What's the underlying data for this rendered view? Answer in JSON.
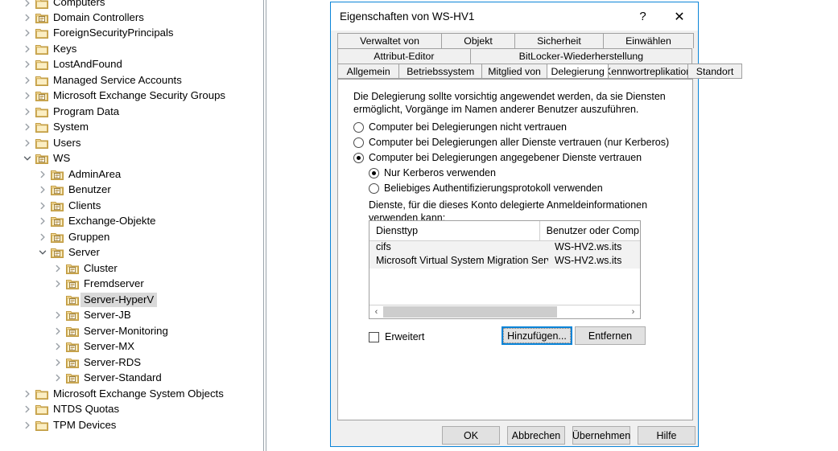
{
  "tree": {
    "items": [
      {
        "label": "Computers",
        "depth": 1,
        "twisty": "collapsed",
        "icon": "folder-plain-icon",
        "selected": false,
        "clipped_top": true
      },
      {
        "label": "Domain Controllers",
        "depth": 1,
        "twisty": "collapsed",
        "icon": "folder-ou-icon",
        "selected": false
      },
      {
        "label": "ForeignSecurityPrincipals",
        "depth": 1,
        "twisty": "collapsed",
        "icon": "folder-plain-icon",
        "selected": false
      },
      {
        "label": "Keys",
        "depth": 1,
        "twisty": "collapsed",
        "icon": "folder-plain-icon",
        "selected": false
      },
      {
        "label": "LostAndFound",
        "depth": 1,
        "twisty": "collapsed",
        "icon": "folder-plain-icon",
        "selected": false
      },
      {
        "label": "Managed Service Accounts",
        "depth": 1,
        "twisty": "collapsed",
        "icon": "folder-plain-icon",
        "selected": false
      },
      {
        "label": "Microsoft Exchange Security Groups",
        "depth": 1,
        "twisty": "collapsed",
        "icon": "folder-ou-icon",
        "selected": false
      },
      {
        "label": "Program Data",
        "depth": 1,
        "twisty": "collapsed",
        "icon": "folder-plain-icon",
        "selected": false
      },
      {
        "label": "System",
        "depth": 1,
        "twisty": "collapsed",
        "icon": "folder-plain-icon",
        "selected": false
      },
      {
        "label": "Users",
        "depth": 1,
        "twisty": "collapsed",
        "icon": "folder-plain-icon",
        "selected": false
      },
      {
        "label": "WS",
        "depth": 1,
        "twisty": "expanded",
        "icon": "folder-ou-icon",
        "selected": false
      },
      {
        "label": "AdminArea",
        "depth": 2,
        "twisty": "collapsed",
        "icon": "folder-ou-icon",
        "selected": false
      },
      {
        "label": "Benutzer",
        "depth": 2,
        "twisty": "collapsed",
        "icon": "folder-ou-icon",
        "selected": false
      },
      {
        "label": "Clients",
        "depth": 2,
        "twisty": "collapsed",
        "icon": "folder-ou-icon",
        "selected": false
      },
      {
        "label": "Exchange-Objekte",
        "depth": 2,
        "twisty": "collapsed",
        "icon": "folder-ou-icon",
        "selected": false
      },
      {
        "label": "Gruppen",
        "depth": 2,
        "twisty": "collapsed",
        "icon": "folder-ou-icon",
        "selected": false
      },
      {
        "label": "Server",
        "depth": 2,
        "twisty": "expanded",
        "icon": "folder-ou-icon",
        "selected": false
      },
      {
        "label": "Cluster",
        "depth": 3,
        "twisty": "collapsed",
        "icon": "folder-ou-icon",
        "selected": false
      },
      {
        "label": "Fremdserver",
        "depth": 3,
        "twisty": "collapsed",
        "icon": "folder-ou-icon",
        "selected": false
      },
      {
        "label": "Server-HyperV",
        "depth": 3,
        "twisty": "none",
        "icon": "folder-ou-icon",
        "selected": true
      },
      {
        "label": "Server-JB",
        "depth": 3,
        "twisty": "collapsed",
        "icon": "folder-ou-icon",
        "selected": false
      },
      {
        "label": "Server-Monitoring",
        "depth": 3,
        "twisty": "collapsed",
        "icon": "folder-ou-icon",
        "selected": false
      },
      {
        "label": "Server-MX",
        "depth": 3,
        "twisty": "collapsed",
        "icon": "folder-ou-icon",
        "selected": false
      },
      {
        "label": "Server-RDS",
        "depth": 3,
        "twisty": "collapsed",
        "icon": "folder-ou-icon",
        "selected": false
      },
      {
        "label": "Server-Standard",
        "depth": 3,
        "twisty": "collapsed",
        "icon": "folder-ou-icon",
        "selected": false
      },
      {
        "label": "Microsoft Exchange System Objects",
        "depth": 1,
        "twisty": "collapsed",
        "icon": "folder-plain-icon",
        "selected": false
      },
      {
        "label": "NTDS Quotas",
        "depth": 1,
        "twisty": "collapsed",
        "icon": "folder-plain-icon",
        "selected": false
      },
      {
        "label": "TPM Devices",
        "depth": 1,
        "twisty": "collapsed",
        "icon": "folder-plain-icon",
        "selected": false
      }
    ]
  },
  "dialog": {
    "title": "Eigenschaften von WS-HV1",
    "help_label": "?",
    "close_label": "✕",
    "accent_color": "#0a84d8",
    "tab_rows": [
      [
        {
          "label": "Verwaltet von",
          "active": false
        },
        {
          "label": "Objekt",
          "active": false
        },
        {
          "label": "Sicherheit",
          "active": false
        },
        {
          "label": "Einwählen",
          "active": false
        }
      ],
      [
        {
          "label": "Attribut-Editor",
          "active": false
        },
        {
          "label": "BitLocker-Wiederherstellung",
          "active": false
        }
      ],
      [
        {
          "label": "Allgemein",
          "active": false
        },
        {
          "label": "Betriebssystem",
          "active": false
        },
        {
          "label": "Mitglied von",
          "active": false
        },
        {
          "label": "Delegierung",
          "active": true
        },
        {
          "label": "Kennwortreplikation",
          "active": false
        },
        {
          "label": "Standort",
          "active": false
        }
      ]
    ],
    "page": {
      "description_line1": "Die Delegierung sollte vorsichtig angewendet werden, da sie Diensten",
      "description_line2": "ermöglicht, Vorgänge im Namen anderer Benutzer auszuführen.",
      "options": [
        {
          "label": "Computer bei Delegierungen nicht vertrauen",
          "selected": false
        },
        {
          "label": "Computer bei Delegierungen aller Dienste vertrauen (nur Kerberos)",
          "selected": false
        },
        {
          "label": "Computer bei Delegierungen angegebener Dienste vertrauen",
          "selected": true
        }
      ],
      "sub_options": [
        {
          "label": "Nur Kerberos verwenden",
          "selected": true
        },
        {
          "label": "Beliebiges Authentifizierungsprotokoll verwenden",
          "selected": false
        }
      ],
      "list_caption_line1": "Dienste, für die dieses Konto delegierte Anmeldeinformationen",
      "list_caption_line2": "verwenden kann:",
      "list": {
        "columns": [
          "Diensttyp",
          "Benutzer oder Comp.."
        ],
        "rows": [
          [
            "cifs",
            "WS-HV2.ws.its"
          ],
          [
            "Microsoft Virtual System Migration Service",
            "WS-HV2.ws.its"
          ]
        ],
        "scroll_left_label": "‹",
        "scroll_right_label": "›"
      },
      "advanced_checkbox_label": "Erweitert",
      "advanced_checked": false,
      "add_button_label": "Hinzufügen...",
      "remove_button_label": "Entfernen"
    },
    "footer": {
      "ok": "OK",
      "cancel": "Abbrechen",
      "apply": "Übernehmen",
      "help": "Hilfe"
    }
  }
}
